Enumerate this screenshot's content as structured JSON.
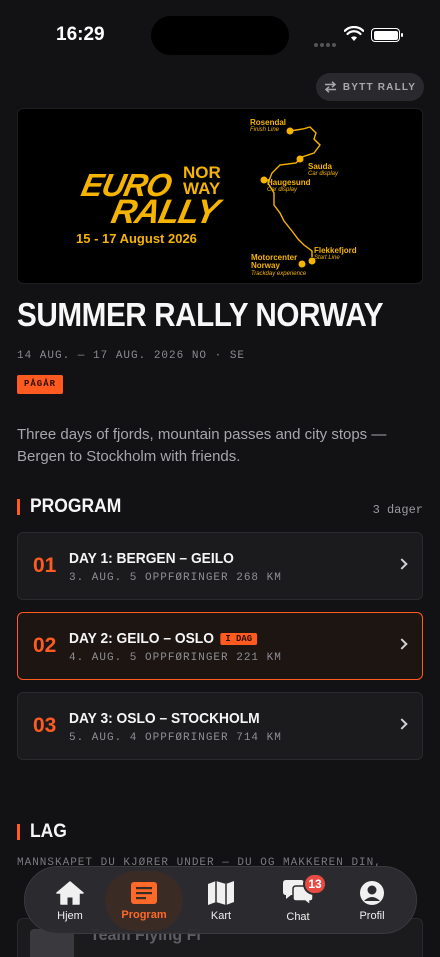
{
  "status_bar": {
    "time": "16:29"
  },
  "header": {
    "switch_label": "BYTT RALLY"
  },
  "banner": {
    "logo_euro": "EURO",
    "logo_nor": "NOR",
    "logo_way": "WAY",
    "logo_rally": "RALLY",
    "dates": "15 - 17 August 2026",
    "places": [
      {
        "name": "Rosendal",
        "note": "Finish Line"
      },
      {
        "name": "Sauda",
        "note": "Car display"
      },
      {
        "name": "Haugesund",
        "note": "Car display"
      },
      {
        "name": "Flekkefjord",
        "note": "Start Line"
      },
      {
        "name": "Motorcenter Norway",
        "note": "Trackday experience"
      }
    ]
  },
  "rally": {
    "title": "SUMMER RALLY NORWAY",
    "meta": "14 AUG. — 17 AUG. 2026  NO · SE",
    "status": "PÅGÅR",
    "description": "Three days of fjords, mountain passes and city stops — Bergen to Stockholm with friends."
  },
  "program": {
    "title": "PROGRAM",
    "count": "3 dager",
    "days": [
      {
        "num": "01",
        "title": "DAY 1: BERGEN – GEILO",
        "sub": "3. AUG.  5 OPPFØRINGER  268 KM",
        "today": ""
      },
      {
        "num": "02",
        "title": "DAY 2: GEILO – OSLO",
        "sub": "4. AUG.  5 OPPFØRINGER  221 KM",
        "today": "I DAG"
      },
      {
        "num": "03",
        "title": "DAY 3: OSLO – STOCKHOLM",
        "sub": "5. AUG.  4 OPPFØRINGER  714 KM",
        "today": ""
      }
    ]
  },
  "team": {
    "title": "LAG",
    "text": "MANNSKAPET DU KJØRER UNDER — DU OG MAKKEREN DIN,",
    "card_name": "Team Flying Fi"
  },
  "tabbar": {
    "tabs": [
      {
        "label": "Hjem",
        "icon": "home-icon"
      },
      {
        "label": "Program",
        "icon": "program-icon"
      },
      {
        "label": "Kart",
        "icon": "map-icon"
      },
      {
        "label": "Chat",
        "icon": "chat-icon"
      },
      {
        "label": "Profil",
        "icon": "profile-icon"
      }
    ],
    "chat_badge": "13"
  },
  "colors": {
    "accent": "#ff5a1f",
    "logo": "#f5b400",
    "background": "#121214"
  }
}
